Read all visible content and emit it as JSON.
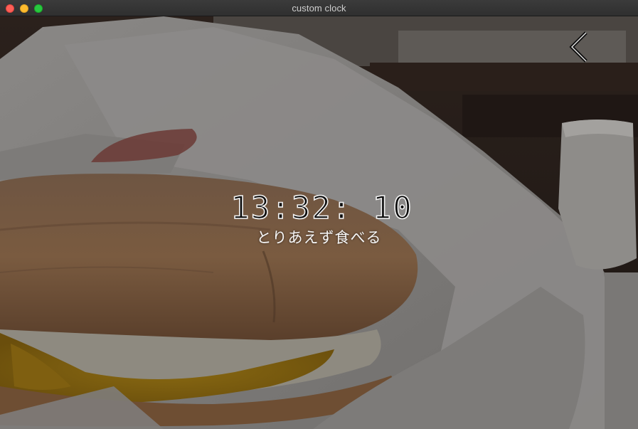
{
  "window": {
    "title": "custom clock"
  },
  "clock": {
    "time": "13:32: 10",
    "caption": "とりあえず食べる"
  },
  "background": {
    "description_icon": "photo-background"
  },
  "colors": {
    "close": "#fe5f57",
    "minimize": "#febc2e",
    "zoom": "#28c840",
    "clock_stroke": "#f2f2f2"
  }
}
